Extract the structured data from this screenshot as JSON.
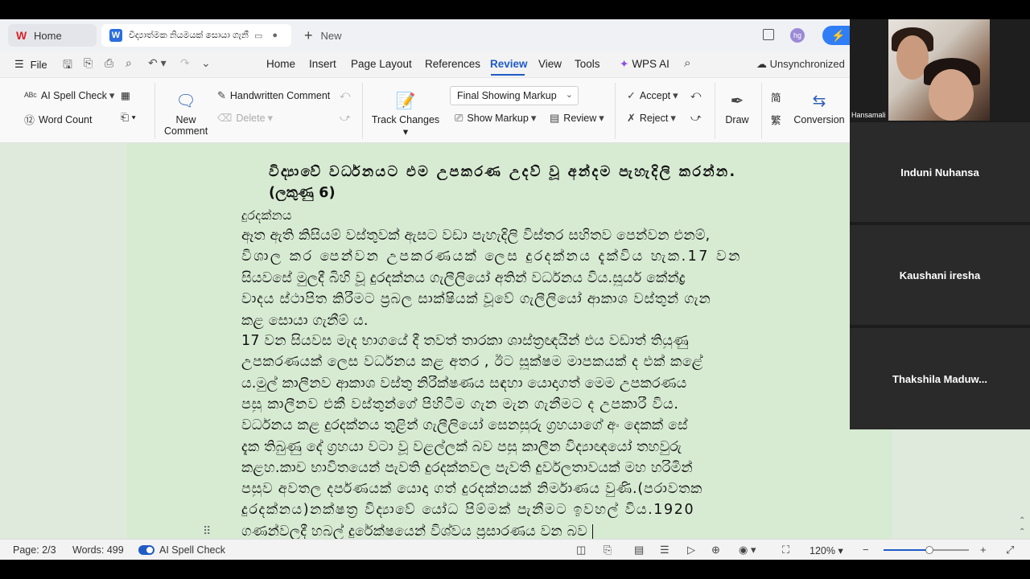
{
  "tabs": {
    "home_label": "Home",
    "doc_title": "විද්‍යාත්මක නියමයක් සොයා ගැනී",
    "new_label": "New",
    "avatar_initials": "hg"
  },
  "menu": {
    "file": "File",
    "tabs": [
      "Home",
      "Insert",
      "Page Layout",
      "References",
      "Review",
      "View",
      "Tools"
    ],
    "active_tab": "Review",
    "wps_ai": "WPS AI",
    "sync_status": "Unsynchronized"
  },
  "ribbon": {
    "spell_check": "AI Spell Check",
    "word_count": "Word Count",
    "new_comment_line1": "New",
    "new_comment_line2": "Comment",
    "handwritten_comment": "Handwritten Comment",
    "delete": "Delete",
    "track_changes": "Track Changes",
    "markup_mode": "Final Showing Markup",
    "show_markup": "Show Markup",
    "review": "Review",
    "accept": "Accept",
    "reject": "Reject",
    "draw": "Draw",
    "conversion": "Conversion"
  },
  "document": {
    "lines": [
      "විද්‍යාවේ වර්ධනයට එම උපකරණ උදව් වූ අන්දම පැහැදිලි කරන්න.",
      "(ලකුණු 6)",
      "දුරදක්නය",
      "ඈත ඇති කිසියම් වස්තුවක් ඇසට වඩා පැහැදිලි විස්තර සහිතව පෙන්වන එනම්,",
      "විශාල කර පෙන්වන උපකරණයක් ලෙස දුරදක්නය දැක්විය හැක.17 වන",
      "සියවසේ මුලදී බිහි වූ දුරදක්නය ගැලීලියෝ අතින් වර්ධනය විය.සූර්ය කේන්ද්‍ර",
      "වාදය ස්ථාපිත කිරීමට ප්‍රබල සාක්ෂියක් වූවේ ගැලීලියෝ ආකාශ වස්තුන් ගැන",
      "කළ සොයා ගැනීම් ය.",
      "17 වන සියවස මැද භාගයේ දී තවත් තාරකා ශාස්ත්‍රඥයින් එය වඩාත් තියුණු",
      "උපකරණයක් ලෙස වර්ධනය කළ අතර , ඊට සූක්ෂම මාපකයක් ද එක් කළේ",
      "ය.මුල් කාලීනව ආකාශ වස්තු නිරීක්ෂණය සඳහා යොදාගත් මෙම උපකරණය",
      "පසු කාලීනව එකී වස්තුන්ගේ පිහිටීම ගැන මැන ගැනීමට ද උපකාරී විය.",
      "වර්ධනය කළ දුරදක්නය තුළින් ගැලීලියෝ සෙනසුරු ග්‍රහයාගේ අං දෙකක් සේ",
      "දැක තිබුණු දේ ග්‍රහයා වටා වූ වළල්ලක් බව පසු කාලීන විද්‍යාඥයෝ තහවුරු",
      "කළහ.කාච භාවිතයෙන් පැවති දුරදක්නවල පැවති දුර්වලතාවයක් මහ හරිමින්",
      "පසුව අවතල දර්පණයක් යොදා ගත් දුරදක්නයක් නිර්මාණය වුණි.(පරාවතක",
      "දුරදක්නය)නක්ෂත්‍ර විද්‍යාවේ යෝධ පිම්මක් පැනීමට ඉවහල් විය.1920",
      "ගණන්වලදී හබල් දුරේක්ෂයෙන් විශ්වය ප්‍රසාරණය වන බව"
    ]
  },
  "status": {
    "page": "Page: 2/3",
    "words": "Words: 499",
    "spell_check": "AI Spell Check",
    "zoom": "120%"
  },
  "video": {
    "self_name": "Hansamali",
    "participants": [
      "Induni Nuhansa",
      "Kaushani iresha",
      "Thakshila  Maduw..."
    ]
  }
}
